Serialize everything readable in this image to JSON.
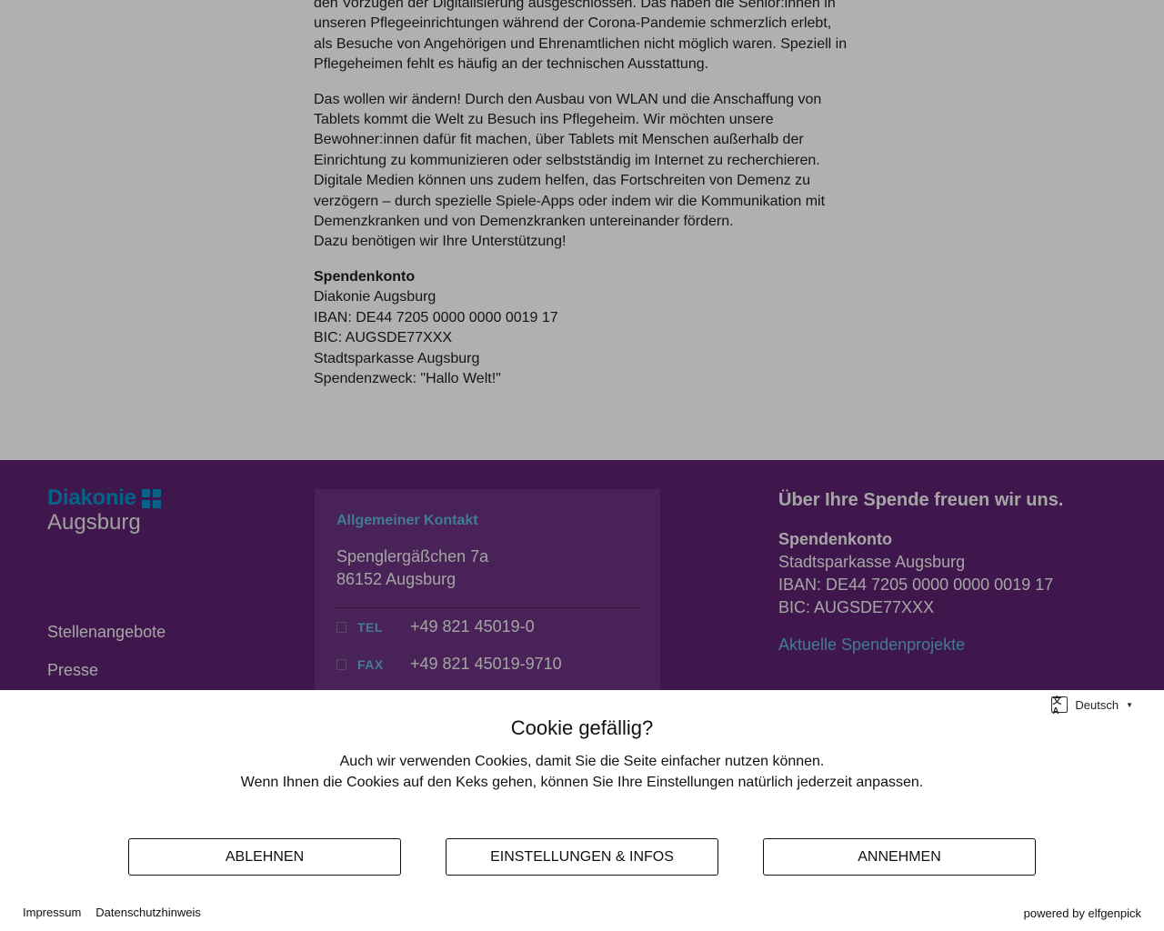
{
  "article": {
    "p1": [
      "den Vorzügen der Digitalisierung ausgeschlossen. Das haben die Senior:innen in",
      "unseren Pflegeeinrichtungen während der Corona-Pandemie schmerzlich erlebt,",
      "als Besuche von Angehörigen und Ehrenamtlichen nicht möglich waren. Speziell in",
      "Pflegeheimen fehlt es häufig an der technischen Ausstattung."
    ],
    "p2": [
      "Das wollen wir ändern! Durch den Ausbau von WLAN und die Anschaffung von",
      "Tablets kommt die Welt zu Besuch ins Pflegeheim. Wir möchten unsere",
      "Bewohner:innen dafür fit machen, über Tablets mit Menschen außerhalb der",
      "Einrichtung zu kommunizieren oder selbstständig im Internet zu recherchieren.",
      "Digitale Medien können uns zudem helfen, das Fortschreiten von Demenz zu",
      "verzögern – durch spezielle Spiele-Apps oder indem wir die Kommunikation mit",
      "Demenzkranken und von Demenzkranken untereinander fördern.",
      "Dazu benötigen wir Ihre Unterstützung!"
    ],
    "account": {
      "heading": "Spendenkonto",
      "lines": [
        "Diakonie Augsburg",
        "IBAN: DE44 7205 0000 0000 0019 17",
        "BIC: AUGSDE77XXX",
        "Stadtsparkasse Augsburg",
        "Spendenzweck: \"Hallo Welt!\""
      ]
    }
  },
  "footer": {
    "logo": {
      "line1": "Diakonie",
      "line2": "Augsburg"
    },
    "nav": [
      "Stellenangebote",
      "Presse"
    ],
    "contact": {
      "title": "Allgemeiner Kontakt",
      "street": "Spenglergäßchen 7a",
      "city": "86152 Augsburg",
      "rows": [
        {
          "label": "TEL",
          "value": "+49 821 45019-0",
          "icon": "phone-icon"
        },
        {
          "label": "FAX",
          "value": "+49 821 45019-9710",
          "icon": "fax-icon"
        }
      ]
    },
    "donate": {
      "heading": "Über Ihre Spende freuen wir uns.",
      "account_heading": "Spendenkonto",
      "lines": [
        "Stadtsparkasse Augsburg",
        "IBAN: DE44 7205 0000 0000 0019 17",
        "BIC: AUGSDE77XXX"
      ],
      "link": "Aktuelle Spendenprojekte"
    }
  },
  "cookie": {
    "language": "Deutsch",
    "title": "Cookie gefällig?",
    "line1": "Auch wir verwenden Cookies, damit Sie die Seite einfacher nutzen können.",
    "line2": "Wenn Ihnen die Cookies auf den Keks gehen, können Sie Ihre Einstellungen natürlich jederzeit anpassen.",
    "buttons": {
      "decline": "ABLEHNEN",
      "settings": "EINSTELLUNGEN & INFOS",
      "accept": "ANNEHMEN"
    },
    "links": {
      "imprint": "Impressum",
      "privacy": "Datenschutzhinweis"
    },
    "powered": "powered by elfgenpick"
  },
  "colors": {
    "footer_bg": "#5c2270",
    "contact_bg": "#6b3380",
    "accent_blue": "#5fb3d8",
    "logo_blue": "#0a8fc7",
    "overlay": "rgba(0,0,0,0.31)"
  }
}
